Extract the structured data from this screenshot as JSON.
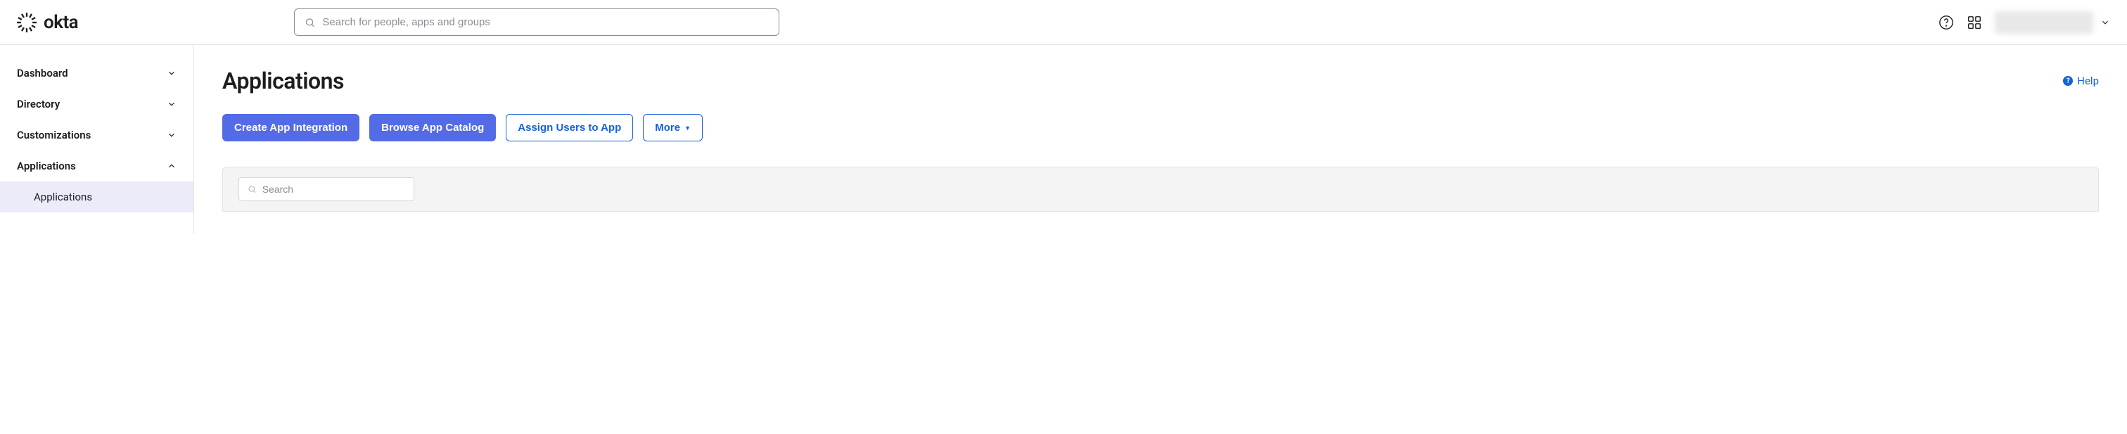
{
  "header": {
    "logo_text": "okta",
    "search_placeholder": "Search for people, apps and groups"
  },
  "sidebar": {
    "items": [
      {
        "label": "Dashboard",
        "expanded": false
      },
      {
        "label": "Directory",
        "expanded": false
      },
      {
        "label": "Customizations",
        "expanded": false
      },
      {
        "label": "Applications",
        "expanded": true,
        "children": [
          {
            "label": "Applications",
            "active": true
          }
        ]
      }
    ]
  },
  "main": {
    "page_title": "Applications",
    "help_label": "Help",
    "buttons": {
      "create": "Create App Integration",
      "browse": "Browse App Catalog",
      "assign": "Assign Users to App",
      "more": "More",
      "more_caret": "▼"
    },
    "panel_search_placeholder": "Search"
  }
}
